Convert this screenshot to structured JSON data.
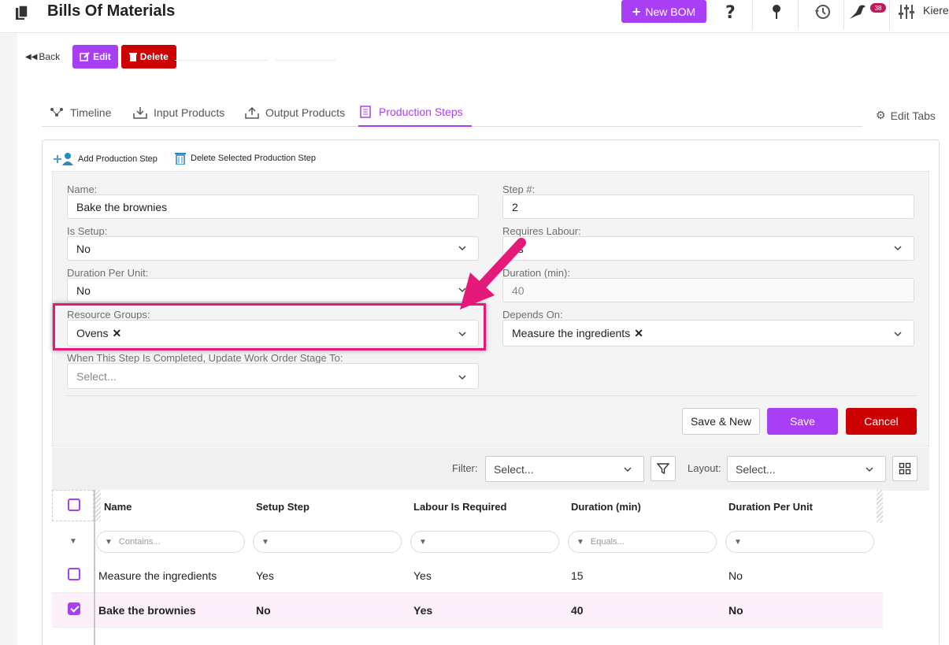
{
  "header": {
    "title": "Bills Of Materials",
    "new_button": "New BOM",
    "notification_count": "38",
    "user_name": "Kieren"
  },
  "actions": {
    "back": "Back",
    "edit": "Edit",
    "delete": "Delete"
  },
  "tabs": [
    {
      "label": "Timeline",
      "icon": "timeline-icon",
      "active": false
    },
    {
      "label": "Input Products",
      "icon": "tray-in-icon",
      "active": false
    },
    {
      "label": "Output Products",
      "icon": "tray-out-icon",
      "active": false
    },
    {
      "label": "Production Steps",
      "icon": "list-icon",
      "active": true
    }
  ],
  "edit_tabs": "Edit Tabs",
  "toolbar": {
    "add": "Add Production Step",
    "delete_selected": "Delete Selected Production Step"
  },
  "form": {
    "name_label": "Name:",
    "name_value": "Bake the brownies",
    "step_label": "Step #:",
    "step_value": "2",
    "is_setup_label": "Is Setup:",
    "is_setup_value": "No",
    "requires_labour_label": "Requires Labour:",
    "requires_labour_value": "es",
    "duration_per_unit_label": "Duration Per Unit:",
    "duration_per_unit_value": "No",
    "duration_min_label": "Duration (min):",
    "duration_min_value": "40",
    "resource_groups_label": "Resource Groups:",
    "resource_groups_value": "Ovens",
    "depends_on_label": "Depends On:",
    "depends_on_value": "Measure the ingredients",
    "stage_label": "When This Step Is Completed, Update Work Order Stage To:",
    "stage_placeholder": "Select...",
    "save_new": "Save & New",
    "save": "Save",
    "cancel": "Cancel"
  },
  "grid_toolbar": {
    "filter_label": "Filter:",
    "filter_placeholder": "Select...",
    "layout_label": "Layout:",
    "layout_placeholder": "Select..."
  },
  "grid": {
    "columns": [
      "Name",
      "Setup Step",
      "Labour Is Required",
      "Duration (min)",
      "Duration Per Unit"
    ],
    "filters": [
      "Contains...",
      "",
      "",
      "Equals...",
      ""
    ],
    "rows": [
      {
        "name": "Measure the ingredients",
        "setup": "Yes",
        "labour": "Yes",
        "duration": "15",
        "per_unit": "No",
        "selected": false
      },
      {
        "name": "Bake the brownies",
        "setup": "No",
        "labour": "Yes",
        "duration": "40",
        "per_unit": "No",
        "selected": true
      }
    ]
  },
  "colors": {
    "accent": "#a93ff5",
    "danger": "#cc0000",
    "annotation": "#e5197a"
  }
}
